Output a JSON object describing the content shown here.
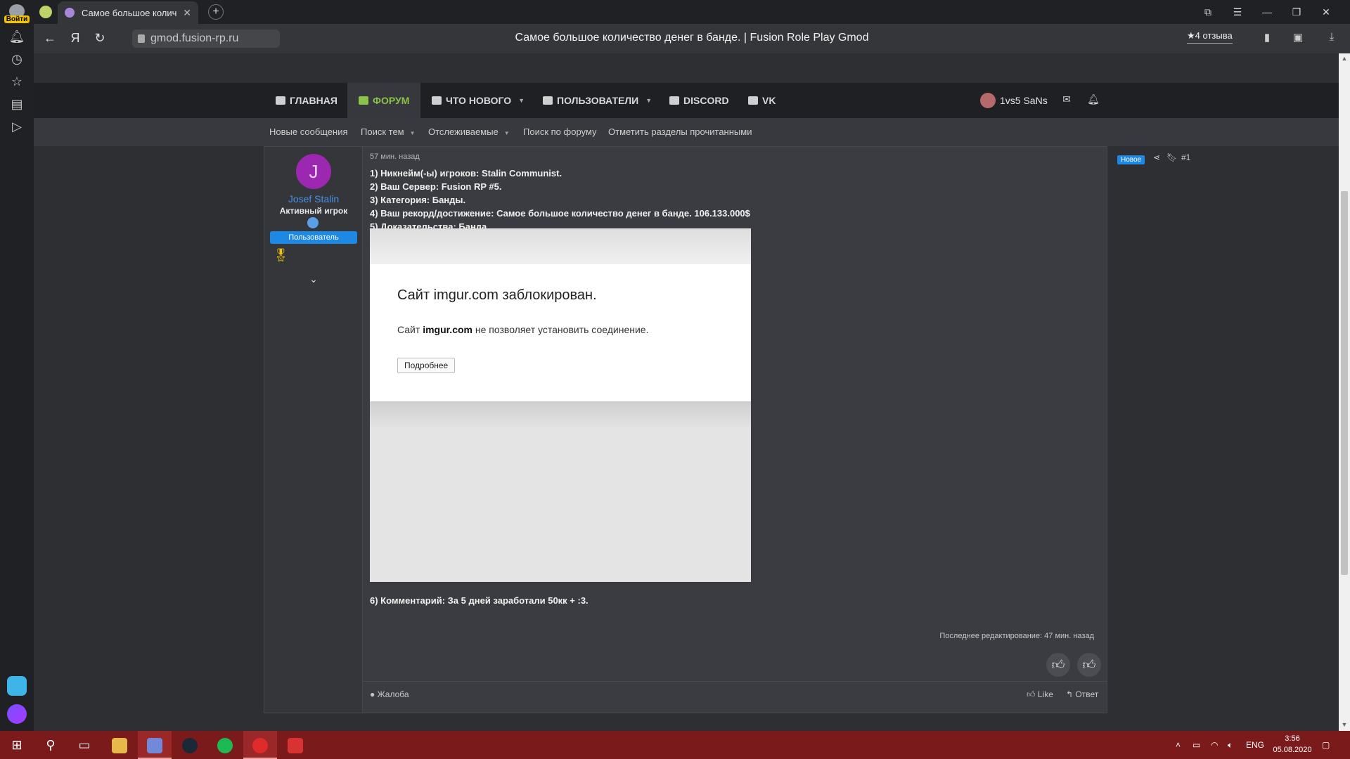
{
  "browser": {
    "login_label": "Войти",
    "tab_title": "Самое большое количество денег в банде. | Fusion Role Play Gmod",
    "tab_title_short": "Самое большое колич",
    "url": "gmod.fusion-rp.ru",
    "page_title": "Самое большое количество денег в банде. | Fusion Role Play Gmod",
    "reviews": "★4 отзыва"
  },
  "forum_nav": {
    "items": [
      {
        "label": "ГЛАВНАЯ",
        "icon": "home-icon"
      },
      {
        "label": "ФОРУМ",
        "icon": "comment-icon",
        "active": true
      },
      {
        "label": "ЧТО НОВОГО",
        "icon": "news-icon"
      },
      {
        "label": "ПОЛЬЗОВАТЕЛИ",
        "icon": "users-icon"
      },
      {
        "label": "DISCORD",
        "icon": "folder-icon"
      },
      {
        "label": "VK",
        "icon": "folder-icon"
      }
    ],
    "username": "1vs5 SaNs"
  },
  "sub_nav": [
    "Новые сообщения",
    "Поиск тем",
    "Отслеживаемые",
    "Поиск по форуму",
    "Отметить разделы прочитанными"
  ],
  "post": {
    "author": {
      "initial": "J",
      "name": "Josef Stalin",
      "title": "Активный игрок",
      "role": "Пользователь"
    },
    "date": "57 мин. назад",
    "badge": "Новое",
    "number": "#1",
    "lines": [
      "1) Никнейм(-ы) игроков: Stalin Communist.",
      "2) Ваш Сервер: Fusion RP #5.",
      "3) Категория: Банды.",
      "4) Ваш рекорд/достижение: Самое большое количество денег в банде. 106.133.000$",
      "5) Доказательства: Банда"
    ],
    "embed": {
      "heading": "Сайт imgur.com заблокирован.",
      "text_prefix": "Сайт ",
      "domain": "imgur.com",
      "text_suffix": " не позволяет установить соединение.",
      "button": "Подробнее"
    },
    "comment": "6) Комментарий: За 5 дней заработали 50кк + :3.",
    "edited": "Последнее редактирование: 47 мин. назад",
    "report": "Жалоба",
    "like": "Like",
    "reply": "Ответ"
  },
  "taskbar": {
    "lang": "ENG",
    "time": "3:56",
    "date": "05.08.2020"
  },
  "colors": {
    "accent_green": "#8bc34a",
    "accent_blue": "#1e88e5",
    "taskbar": "#7a1a1a"
  }
}
